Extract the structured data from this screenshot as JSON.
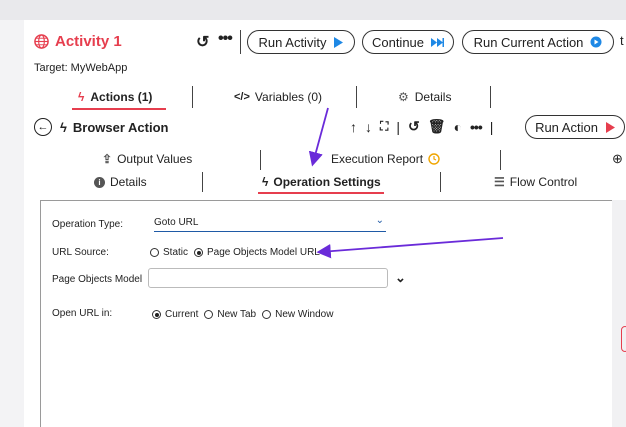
{
  "header": {
    "title": "Activity 1",
    "buttons": {
      "run_activity": "Run Activity",
      "continue": "Continue",
      "run_current_action": "Run Current Action",
      "overflow": "t"
    },
    "target": "Target: MyWebApp"
  },
  "activity_tabs": [
    {
      "label": "Actions (1)",
      "active": true
    },
    {
      "label": "Variables (0)",
      "active": false
    },
    {
      "label": "Details",
      "active": false
    }
  ],
  "action": {
    "title": "Browser Action",
    "run_button": "Run Action"
  },
  "action_tabs": {
    "row1": [
      {
        "label": "Output Values"
      },
      {
        "label": "Execution Report"
      }
    ],
    "row2": [
      {
        "label": "Details",
        "active": false
      },
      {
        "label": "Operation Settings",
        "active": true
      },
      {
        "label": "Flow Control",
        "active": false
      }
    ]
  },
  "form": {
    "operation_type": {
      "label": "Operation Type:",
      "value": "Goto URL"
    },
    "url_source": {
      "label": "URL Source:",
      "options": [
        {
          "label": "Static",
          "selected": false
        },
        {
          "label": "Page Objects Model URL",
          "selected": true
        }
      ]
    },
    "page_objects_model": {
      "label": "Page Objects Model",
      "value": ""
    },
    "open_url_in": {
      "label": "Open URL in:",
      "options": [
        {
          "label": "Current",
          "selected": true
        },
        {
          "label": "New Tab",
          "selected": false
        },
        {
          "label": "New Window",
          "selected": false
        }
      ]
    }
  },
  "colors": {
    "accent": "#e63e4e",
    "annotation_arrow": "#6a2bd9",
    "play_icon": "#1e88e5",
    "clock_icon": "#f0a500"
  }
}
